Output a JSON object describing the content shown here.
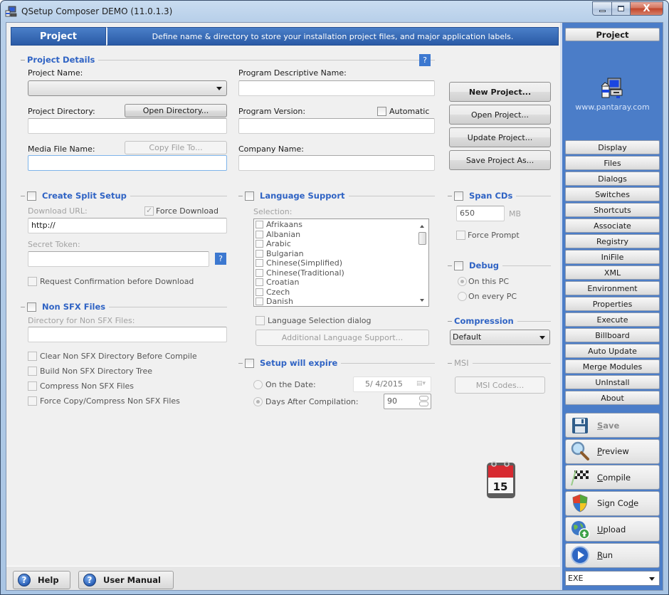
{
  "window": {
    "title": "QSetup Composer DEMO (11.0.1.3)",
    "controls": {
      "minimize": "minimize",
      "maximize": "maximize",
      "close": "X"
    }
  },
  "header": {
    "tab_label": "Project",
    "description": "Define name & directory to store your installation project files, and major application labels."
  },
  "project_details": {
    "title": "Project Details",
    "help": "?",
    "project_name_label": "Project Name:",
    "project_name_value": "",
    "program_descriptive_name_label": "Program Descriptive Name:",
    "program_descriptive_name_value": "",
    "project_directory_label": "Project Directory:",
    "open_directory_button": "Open Directory...",
    "project_directory_value": "",
    "program_version_label": "Program Version:",
    "automatic_label": "Automatic",
    "automatic_checked": false,
    "program_version_value": "",
    "media_file_name_label": "Media File Name:",
    "copy_file_to_button": "Copy File To...",
    "media_file_name_value": "",
    "company_name_label": "Company Name:",
    "company_name_value": ""
  },
  "project_actions": {
    "new_project": "New Project...",
    "open_project": "Open Project...",
    "update_project": "Update Project...",
    "save_project_as": "Save Project As..."
  },
  "split_setup": {
    "title": "Create Split Setup",
    "enabled": false,
    "download_url_label": "Download URL:",
    "force_download_label": "Force Download",
    "force_download_checked": true,
    "download_url_value": "http://",
    "secret_token_label": "Secret Token:",
    "secret_token_value": "",
    "help": "?",
    "request_confirmation_label": "Request Confirmation before Download"
  },
  "non_sfx": {
    "title": "Non SFX Files",
    "enabled": false,
    "directory_label": "Directory for Non SFX Files:",
    "directory_value": "",
    "options": [
      "Clear Non SFX Directory Before Compile",
      "Build Non SFX Directory Tree",
      "Compress Non SFX Files",
      "Force Copy/Compress Non SFX Files"
    ]
  },
  "language_support": {
    "title": "Language Support",
    "enabled": false,
    "selection_label": "Selection:",
    "languages": [
      "Afrikaans",
      "Albanian",
      "Arabic",
      "Bulgarian",
      "Chinese(Simplified)",
      "Chinese(Traditional)",
      "Croatian",
      "Czech",
      "Danish"
    ],
    "language_selection_dialog_label": "Language Selection dialog",
    "additional_button": "Additional Language Support..."
  },
  "expire": {
    "title": "Setup will expire",
    "enabled": false,
    "on_date_label": "On the Date:",
    "date_value": "5/ 4/2015",
    "days_after_label": "Days After Compilation:",
    "days_value": "90",
    "selected": "days_after"
  },
  "span_cds": {
    "title": "Span CDs",
    "enabled": false,
    "size_value": "650",
    "unit": "MB",
    "force_prompt_label": "Force Prompt"
  },
  "debug": {
    "title": "Debug",
    "enabled": false,
    "on_this_pc": "On this PC",
    "on_every_pc": "On every PC",
    "selected": "on_this_pc"
  },
  "compression": {
    "title": "Compression",
    "value": "Default"
  },
  "msi": {
    "title": "MSI",
    "codes_button": "MSI Codes..."
  },
  "footer": {
    "help": "Help",
    "user_manual": "User Manual"
  },
  "sidebar": {
    "active": "Project",
    "brand_url": "www.pantaray.com",
    "items": [
      "Display",
      "Files",
      "Dialogs",
      "Switches",
      "Shortcuts",
      "Associate",
      "Registry",
      "IniFile",
      "XML",
      "Environment",
      "Properties",
      "Execute",
      "Billboard",
      "Auto Update",
      "Merge Modules",
      "UnInstall",
      "About"
    ],
    "actions": [
      {
        "label": "Save",
        "mnemonic": "S",
        "rest": "ave",
        "icon": "floppy-disk-icon",
        "enabled": false
      },
      {
        "label": "Preview",
        "mnemonic": "P",
        "rest": "review",
        "icon": "magnifier-icon",
        "enabled": true
      },
      {
        "label": "Compile",
        "mnemonic": "C",
        "rest": "ompile",
        "icon": "checkered-flag-icon",
        "enabled": true
      },
      {
        "label": "Sign Code",
        "pre": "Sign Co",
        "mnemonic": "d",
        "rest": "e",
        "icon": "shield-icon",
        "enabled": true
      },
      {
        "label": "Upload",
        "mnemonic": "U",
        "rest": "pload",
        "icon": "globe-upload-icon",
        "enabled": true
      },
      {
        "label": "Run",
        "mnemonic": "R",
        "rest": "un",
        "icon": "play-icon",
        "enabled": true
      }
    ],
    "output_type": "EXE"
  },
  "colors": {
    "accent_blue": "#2f63c4",
    "header_blue": "#2a5aa6",
    "sidebar_blue": "#4b7dc8",
    "window_bg": "#f0f0f0"
  }
}
